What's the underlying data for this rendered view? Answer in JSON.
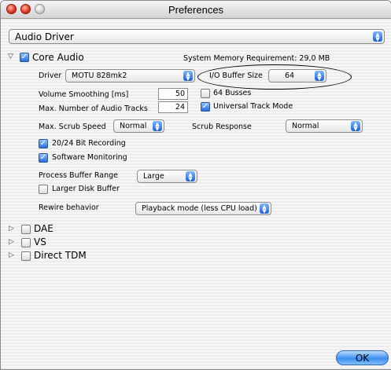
{
  "window": {
    "title": "Preferences"
  },
  "category_popup": {
    "value": "Audio Driver"
  },
  "core_audio": {
    "label": "Core Audio",
    "system_memory": "System Memory Requirement: 29,0 MB",
    "driver_label": "Driver",
    "driver_value": "MOTU 828mk2",
    "io_buffer_label": "I/O Buffer Size",
    "io_buffer_value": "64",
    "volume_smoothing_label": "Volume Smoothing [ms]",
    "volume_smoothing_value": "50",
    "busses_label": "64 Busses",
    "max_tracks_label": "Max. Number of Audio Tracks",
    "max_tracks_value": "24",
    "universal_track_label": "Universal Track Mode",
    "scrub_speed_label": "Max. Scrub Speed",
    "scrub_speed_value": "Normal",
    "scrub_response_label": "Scrub Response",
    "scrub_response_value": "Normal",
    "bit_recording_label": "20/24 Bit Recording",
    "software_monitoring_label": "Software Monitoring",
    "process_buffer_label": "Process Buffer Range",
    "process_buffer_value": "Large",
    "larger_disk_label": "Larger Disk Buffer",
    "rewire_label": "Rewire behavior",
    "rewire_value": "Playback mode (less CPU load)"
  },
  "other_drivers": [
    {
      "label": "DAE"
    },
    {
      "label": "VS"
    },
    {
      "label": "Direct TDM"
    }
  ],
  "ok_label": "OK"
}
